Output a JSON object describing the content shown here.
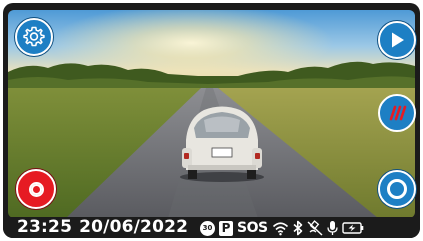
{
  "status_bar": {
    "time": "23:25",
    "date": "20/06/2022",
    "speed_limit": "30",
    "parking_mode": "P",
    "sos_label": "SOS"
  },
  "buttons": {
    "settings": "gear-icon",
    "playback": "play-icon",
    "parking_guard": "slashes-icon",
    "record": "record-icon",
    "snapshot": "ring-icon"
  },
  "colors": {
    "accent_blue": "#1d7fc4",
    "record_red": "#e61b23",
    "parking_slashes_red": "#e61b23",
    "bezel": "#1b1b1b"
  }
}
